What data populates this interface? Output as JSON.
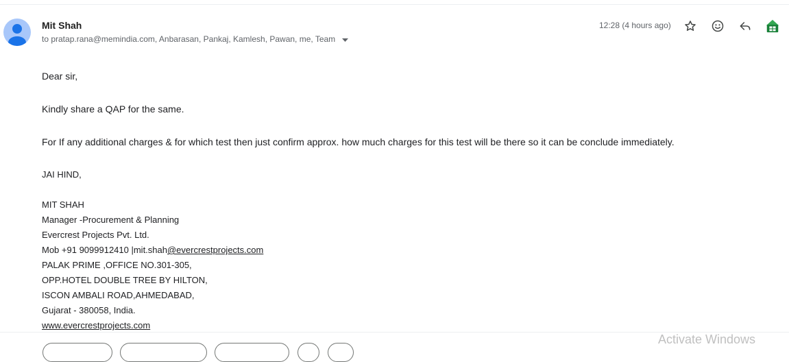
{
  "email": {
    "sender_name": "Mit Shah",
    "recipients": "to pratap.rana@memindia.com, Anbarasan, Pankaj, Kamlesh, Pawan, me, Team",
    "timestamp": "12:28 (4 hours ago)",
    "body": {
      "greeting": "Dear sir,",
      "line1": "Kindly share a QAP for the same.",
      "line2": "For If any additional charges & for which test then just confirm approx. how much charges for this test will be there so it can be conclude immediately.",
      "closing": "JAI HIND,"
    },
    "signature": {
      "name": "MIT SHAH",
      "title": "Manager -Procurement & Planning",
      "company": "Evercrest Projects Pvt. Ltd.",
      "mob_prefix": "Mob +91 9099912410 |mit.shah",
      "mob_link": "@evercrestprojects.com",
      "address1": "PALAK PRIME ,OFFICE NO.301-305,",
      "address2": "OPP.HOTEL DOUBLE TREE BY HILTON,",
      "address3": "ISCON AMBALI ROAD,AHMEDABAD,",
      "address4": "Gujarat - 380058, India.",
      "website": "www.evercrestprojects.com"
    }
  },
  "actions": {
    "icons": [
      "star-icon",
      "emoji-icon",
      "reply-icon",
      "sheets-icon"
    ]
  },
  "watermark": "Activate Windows",
  "colors": {
    "avatar_bg": "#a8c7fa",
    "avatar_fg": "#1a73e8",
    "sheets_green": "#188038"
  }
}
